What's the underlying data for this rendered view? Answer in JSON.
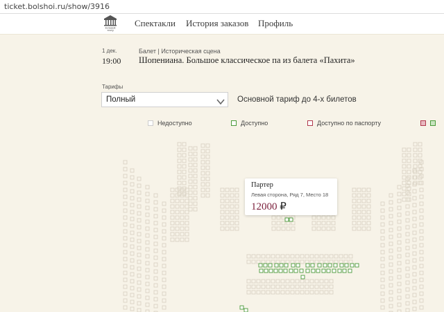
{
  "browser": {
    "url": "ticket.bolshoi.ru/show/3916"
  },
  "header": {
    "logo_text": "Большой театр",
    "nav": [
      {
        "label": "Спектакли"
      },
      {
        "label": "История заказов"
      },
      {
        "label": "Профиль"
      }
    ]
  },
  "performance": {
    "date": "1 дек.",
    "time": "19:00",
    "meta": "Балет | Историческая сцена",
    "title": "Шопениана. Большое классическое па из балета «Пахита»"
  },
  "tariff": {
    "label": "Тарифы",
    "selected": "Полный",
    "description": "Основной тариф до 4-х билетов"
  },
  "legend": [
    {
      "label": "Недоступно",
      "border": "#cccccc"
    },
    {
      "label": "Доступно",
      "border": "#4a9a3a"
    },
    {
      "label": "Доступно по паспорту",
      "border": "#b0384c"
    }
  ],
  "tooltip": {
    "zone": "Партер",
    "place": "Левая сторона, Ряд 7, Место 18",
    "price": "12000",
    "currency": "₽"
  },
  "colors": {
    "background": "#f7f3e8",
    "seat_unavailable": "#d9d3c4",
    "seat_available": "#4a9a3a",
    "price": "#7a1e3a"
  }
}
